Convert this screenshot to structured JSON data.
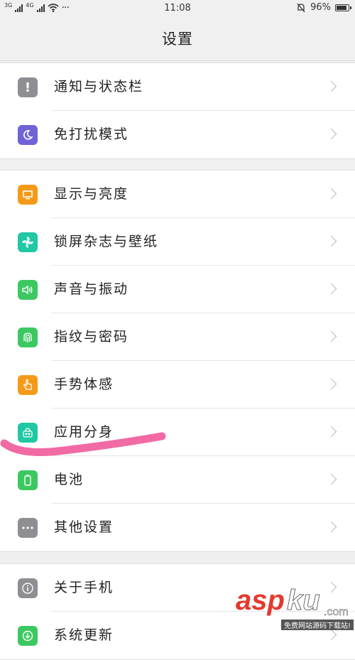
{
  "status_bar": {
    "network_1": "3G",
    "network_2": "4G",
    "more": "···",
    "time": "11:08",
    "battery": "96%",
    "battery_level": 0.96
  },
  "header": {
    "title": "设置"
  },
  "groups": [
    [
      {
        "label": "通知与状态栏",
        "icon": "notification-icon",
        "color": "#8e8e93"
      },
      {
        "label": "免打扰模式",
        "icon": "moon-icon",
        "color": "#6f63d8"
      }
    ],
    [
      {
        "label": "显示与亮度",
        "icon": "display-icon",
        "color": "#f59a18"
      },
      {
        "label": "锁屏杂志与壁纸",
        "icon": "pinwheel-icon",
        "color": "#20c8a4"
      },
      {
        "label": "声音与振动",
        "icon": "speaker-icon",
        "color": "#3cc860"
      },
      {
        "label": "指纹与密码",
        "icon": "fingerprint-icon",
        "color": "#3cc860"
      },
      {
        "label": "手势体感",
        "icon": "gesture-icon",
        "color": "#f59a18"
      },
      {
        "label": "应用分身",
        "icon": "clone-app-icon",
        "color": "#20c8a4"
      },
      {
        "label": "电池",
        "icon": "battery-icon",
        "color": "#3cc860"
      },
      {
        "label": "其他设置",
        "icon": "more-icon",
        "color": "#8e8e93"
      }
    ],
    [
      {
        "label": "关于手机",
        "icon": "info-icon",
        "color": "#8e8e93"
      },
      {
        "label": "系统更新",
        "icon": "update-icon",
        "color": "#3cc860"
      }
    ]
  ],
  "watermark": {
    "brand": "aspku",
    "domain": ".com",
    "caption": "免费网站源码下载站!"
  }
}
